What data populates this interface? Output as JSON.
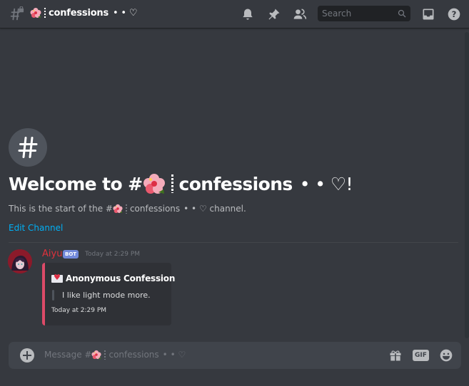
{
  "header": {
    "channel_name_prefix_emoji": "hibiscus",
    "channel_name": "confessions",
    "channel_name_suffix": "•  • ♡",
    "channel_icon": "locked-hash-icon",
    "search_placeholder": "Search",
    "icons": [
      "bell-icon",
      "pin-icon",
      "members-icon",
      "search-icon",
      "inbox-icon",
      "help-icon"
    ]
  },
  "welcome": {
    "hash_symbol": "#",
    "title_prefix": "Welcome to #",
    "title_name": "confessions",
    "title_suffix": "•  • ♡!",
    "sub_prefix": "This is the start of the #",
    "sub_name": "confessions",
    "sub_suffix": "•  • ♡ channel.",
    "edit_channel_label": "Edit Channel"
  },
  "message": {
    "author": "Aiyu",
    "author_color": "#e0313c",
    "bot_tag": "BOT",
    "timestamp": "Today at 2:29 PM",
    "embed": {
      "accent_color": "#dd4a68",
      "title": "Anonymous Confession",
      "description": "I like light mode more.",
      "footer": "Today at 2:29 PM"
    }
  },
  "composer": {
    "placeholder_prefix": "Message #",
    "placeholder_name": "confessions",
    "placeholder_suffix": "•  • ♡",
    "gif_label": "GIF"
  }
}
